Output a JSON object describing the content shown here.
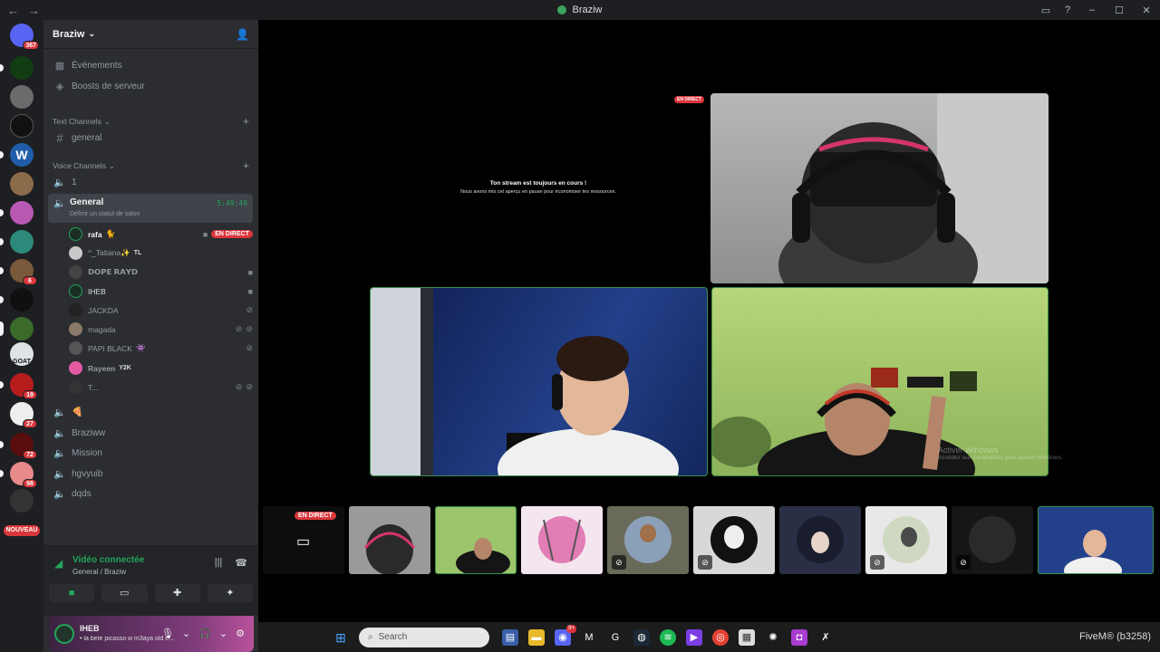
{
  "window": {
    "title": "Braziw",
    "back_icon": "←",
    "forward_icon": "→"
  },
  "servers": {
    "badges": [
      "367",
      "6",
      "19",
      "27",
      "72",
      "98"
    ],
    "w_letter": "W",
    "goat_label": "GOAT",
    "new_label": "NOUVEAU"
  },
  "sidebar": {
    "guild_name": "Braziw",
    "events": "Événements",
    "boosts": "Boosts de serveur",
    "text_category": "Text Channels",
    "text_channels": [
      "general"
    ],
    "voice_category": "Voice Channels",
    "voice_channel_1": "1",
    "active_channel": {
      "name": "General",
      "status": "Définir un statut de salon",
      "timer": "5:49:49"
    },
    "members": [
      {
        "name": "rafa",
        "tag": "",
        "live": "EN DIRECT"
      },
      {
        "name": "^_Tatiana✨",
        "tag": "TL"
      },
      {
        "name": "𝗗𝗢𝗣𝗘 𝗥𝗔𝗬𝗗",
        "tag": ""
      },
      {
        "name": "IHEB",
        "tag": ""
      },
      {
        "name": "JACKDA",
        "tag": ""
      },
      {
        "name": "magada",
        "tag": ""
      },
      {
        "name": "PAPI BLACK",
        "tag": ""
      },
      {
        "name": "Rayeen",
        "tag": "Y2K"
      },
      {
        "name": "T...",
        "tag": ""
      }
    ],
    "other_voice": [
      "🍕",
      "Braziww",
      "Mission",
      "hgvyuib",
      "dqds"
    ]
  },
  "voice_panel": {
    "status": "Vidéo connectée",
    "channel": "General / Braziw"
  },
  "user_panel": {
    "name": "IHEB",
    "status": "• la bete picasso w m3aya old e..."
  },
  "stage": {
    "paused_title": "Ton stream est toujours en cours !",
    "paused_sub": "Nous avons mis cet aperçu en pause pour économiser tes ressources.",
    "live_label": "EN DIRECT",
    "thumb_live_label": "EN DIRECT"
  },
  "watermark": {
    "line1": "Activer Windows",
    "line2": "Accédez aux paramètres pour activer Windows."
  },
  "taskbar": {
    "search_placeholder": "Search",
    "tray_text": "FiveM® (b3258)",
    "discord_badge": "9+"
  },
  "colors": {
    "green": "#23a55a",
    "red": "#da373c",
    "sidebar": "#2b2d31",
    "rail": "#1e1f22"
  }
}
